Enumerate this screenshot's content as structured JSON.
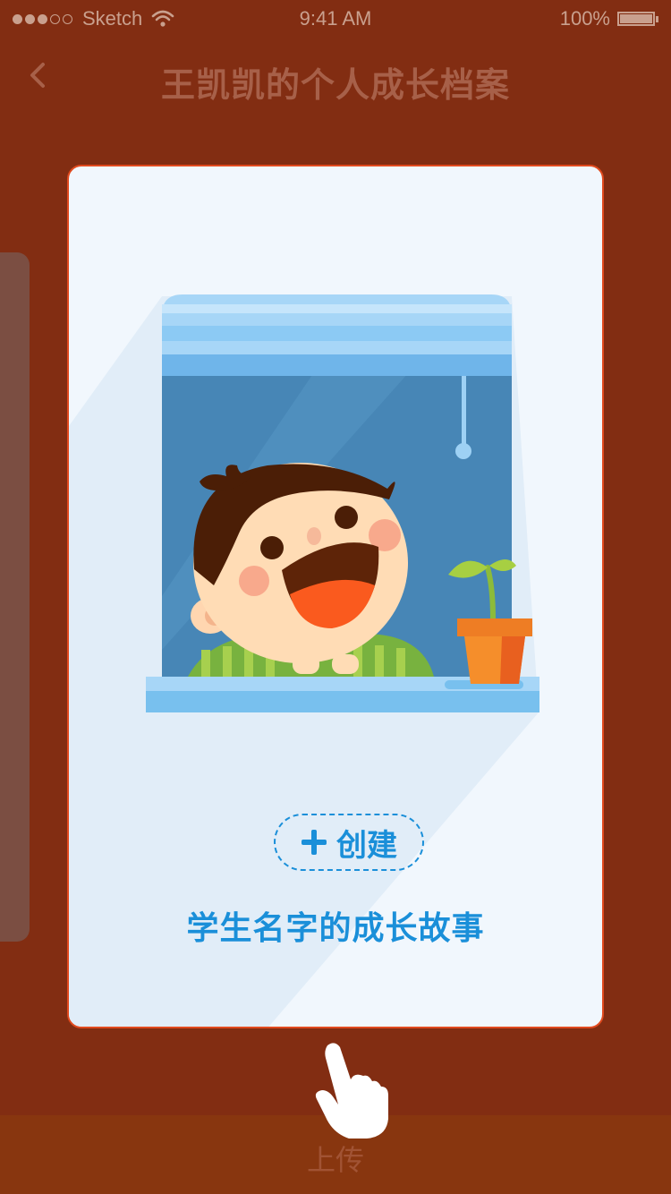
{
  "status_bar": {
    "carrier": "Sketch",
    "time": "9:41 AM",
    "battery": "100%",
    "battery_level": 1.0,
    "signal_bars": 5,
    "signal_filled": 3,
    "icons": [
      "wifi-icon",
      "battery-icon",
      "signal-dots-icon"
    ]
  },
  "nav": {
    "back_icon": "chevron-left-icon",
    "title": "王凯凯的个人成长档案"
  },
  "card": {
    "illustration": "boy-at-window-illustration",
    "create_label": "创建",
    "create_icon": "plus-icon",
    "story_text": "学生名字的成长故事"
  },
  "bottom": {
    "upload_label": "上传",
    "hint_icon": "hand-pointer-icon"
  },
  "colors": {
    "background": "#822d12",
    "card_border": "#e14a1e",
    "accent_blue": "#1a8fd9"
  }
}
